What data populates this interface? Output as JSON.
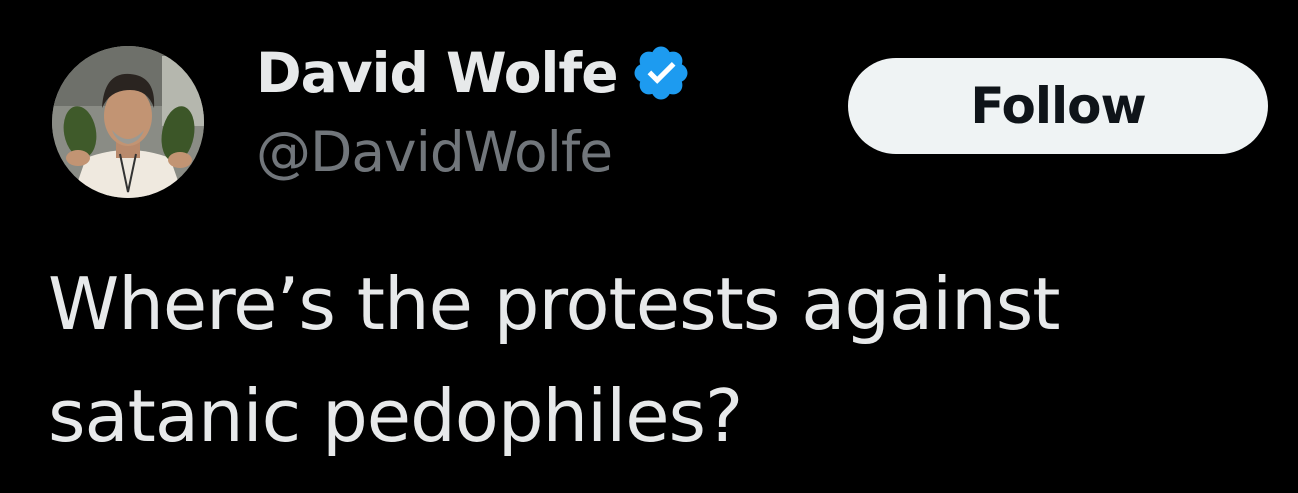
{
  "tweet": {
    "author": {
      "display_name": "David Wolfe",
      "handle": "@DavidWolfe",
      "verified": true,
      "avatar_icon": "profile-photo"
    },
    "follow_label": "Follow",
    "text_lines": [
      "Where’s the protests against",
      "satanic pedophiles?"
    ]
  },
  "colors": {
    "background": "#000000",
    "text_primary": "#e7e9ea",
    "text_secondary": "#71767b",
    "verified_blue": "#1d9bf0",
    "button_bg": "#eff3f4",
    "button_text": "#0f1419"
  }
}
